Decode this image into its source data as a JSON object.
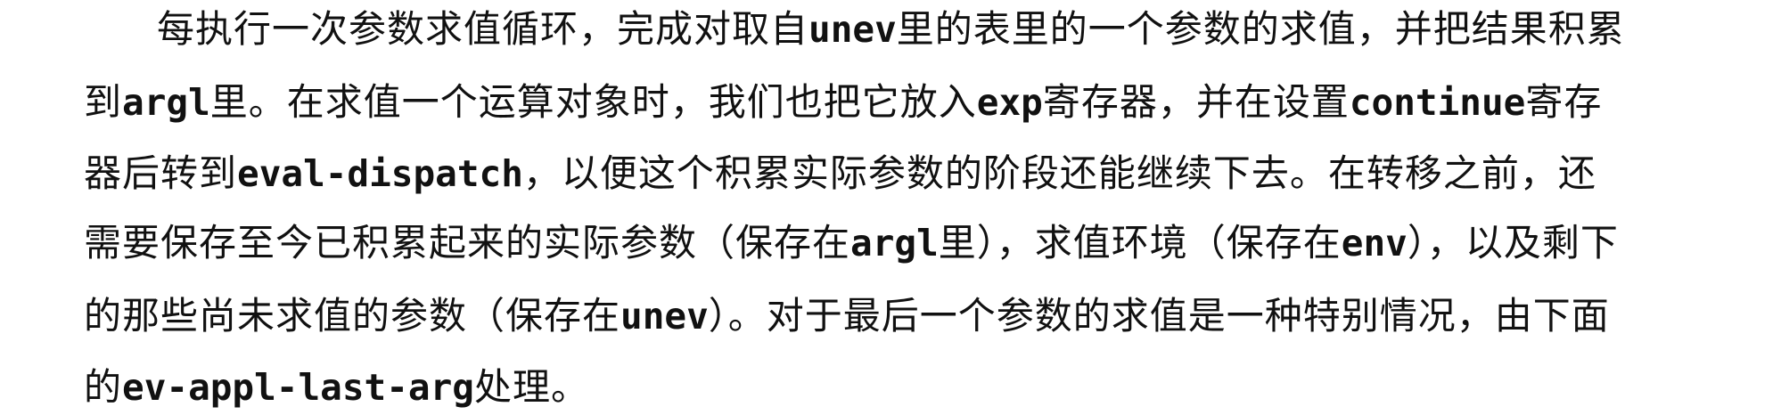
{
  "paragraph": {
    "lines": [
      [
        {
          "t": "每执行一次参数求值循环，完成对取自"
        },
        {
          "t": "unev",
          "code": true
        },
        {
          "t": "里的表里的一个参数的求值，并把结果积累"
        }
      ],
      [
        {
          "t": "到"
        },
        {
          "t": "argl",
          "code": true
        },
        {
          "t": "里。在求值一个运算对象时，我们也把它放入"
        },
        {
          "t": "exp",
          "code": true
        },
        {
          "t": "寄存器，并在设置"
        },
        {
          "t": "continue",
          "code": true
        },
        {
          "t": "寄存"
        }
      ],
      [
        {
          "t": "器后转到"
        },
        {
          "t": "eval-dispatch",
          "code": true
        },
        {
          "t": "，以便这个积累实际参数的阶段还能继续下去。在转移之前，还"
        }
      ],
      [
        {
          "t": "需要保存至今已积累起来的实际参数（保存在"
        },
        {
          "t": "argl",
          "code": true
        },
        {
          "t": "里），求值环境（保存在"
        },
        {
          "t": "env",
          "code": true
        },
        {
          "t": "），以及剩下"
        }
      ],
      [
        {
          "t": "的那些尚未求值的参数（保存在"
        },
        {
          "t": "unev",
          "code": true
        },
        {
          "t": "）。对于最后一个参数的求值是一种特别情况，由下面"
        }
      ],
      [
        {
          "t": "的"
        },
        {
          "t": "ev-appl-last-arg",
          "code": true
        },
        {
          "t": "处理。"
        }
      ]
    ]
  }
}
